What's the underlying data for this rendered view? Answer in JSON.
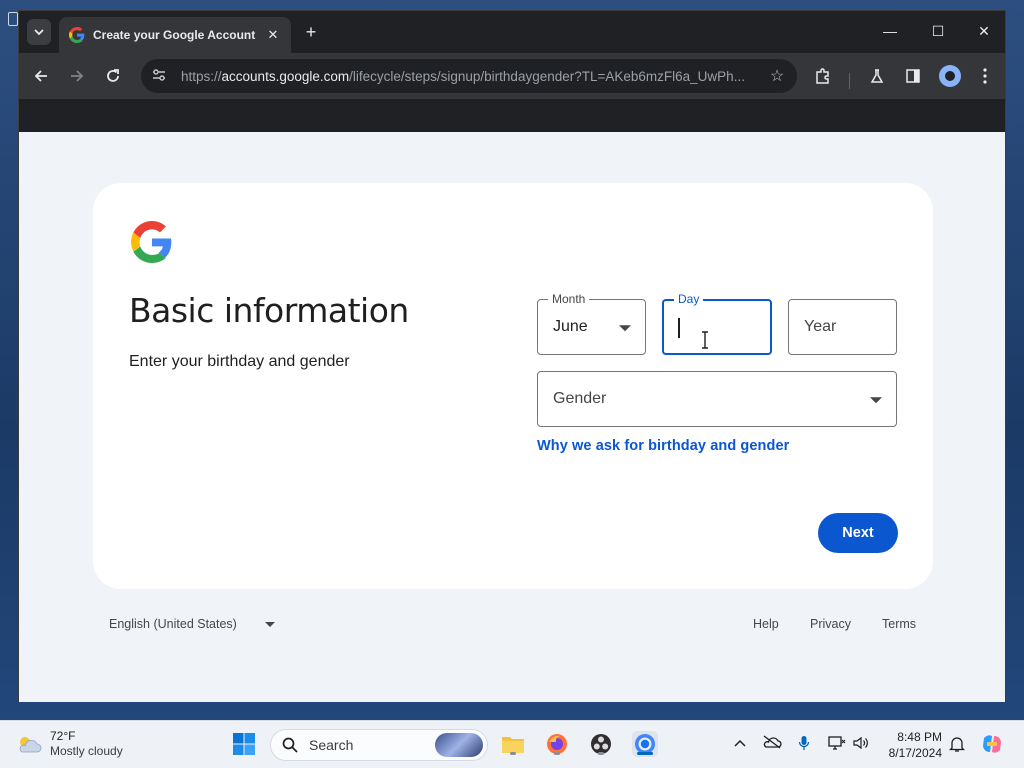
{
  "browser": {
    "tab_title": "Create your Google Account",
    "url_prefix": "https://",
    "url_host": "accounts.google.com",
    "url_path": "/lifecycle/steps/signup/birthdaygender?TL=AKeb6mzFl6a_UwPh..."
  },
  "page": {
    "heading": "Basic information",
    "subheading": "Enter your birthday and gender",
    "month_label": "Month",
    "month_value": "June",
    "day_label": "Day",
    "day_value": "",
    "year_placeholder": "Year",
    "gender_placeholder": "Gender",
    "why_link": "Why we ask for birthday and gender",
    "next_button": "Next"
  },
  "footer": {
    "language": "English (United States)",
    "help": "Help",
    "privacy": "Privacy",
    "terms": "Terms"
  },
  "taskbar": {
    "temperature": "72°F",
    "weather": "Mostly cloudy",
    "search_placeholder": "Search",
    "time": "8:48 PM",
    "date": "8/17/2024"
  },
  "colors": {
    "accent": "#0b57d0",
    "page_bg": "#f0f4f9",
    "chrome_dark": "#202124"
  }
}
